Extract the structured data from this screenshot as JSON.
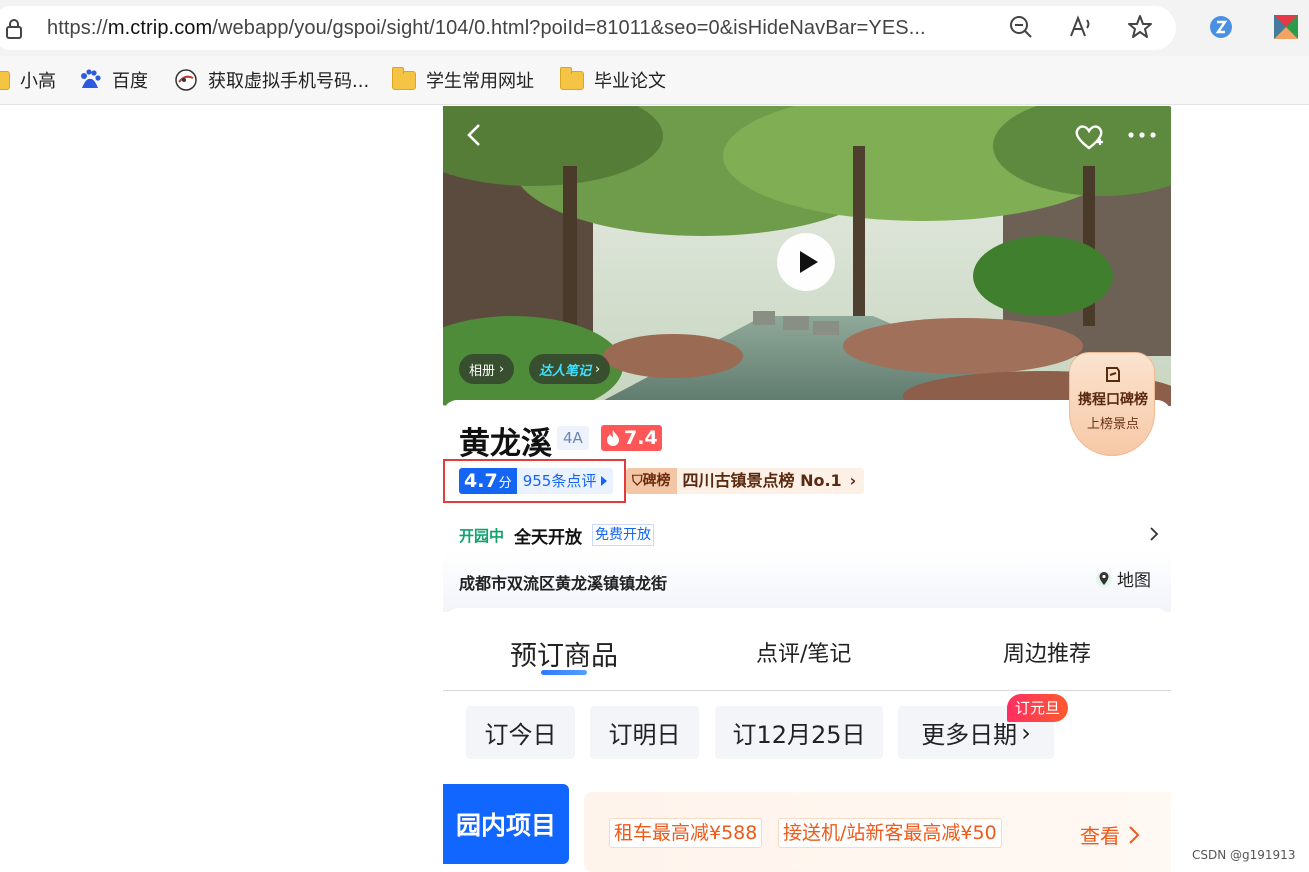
{
  "browser": {
    "url_prefix": "https://",
    "url_domain": "m.ctrip.com",
    "url_path": "/webapp/you/gspoi/sight/104/0.html?poiId=81011&seo=0&isHideNavBar=YES...",
    "icons": [
      "lock-icon",
      "zoom-out-icon",
      "read-aloud-icon",
      "favorite-star-icon",
      "extension-icon",
      "extension-icon-2"
    ]
  },
  "bookmarks": [
    {
      "label": "小高",
      "icon": "folder-icon"
    },
    {
      "label": "百度",
      "icon": "baidu-icon"
    },
    {
      "label": "获取虚拟手机号码...",
      "icon": "site-icon"
    },
    {
      "label": "学生常用网址",
      "icon": "folder-icon"
    },
    {
      "label": "毕业论文",
      "icon": "folder-icon"
    }
  ],
  "hero": {
    "album_label": "相册",
    "notes_label": "达人笔记"
  },
  "poi": {
    "name": "黄龙溪",
    "level": "4A",
    "heat": "7.4",
    "score": "4.7",
    "score_unit": "分",
    "reviews": "955条点评",
    "rank_tag": "碑榜",
    "rank_text": "四川古镇景点榜 No.1",
    "badge_line1": "携程口碑榜",
    "badge_line2": "上榜景点",
    "open_status": "开园中",
    "open_hours": "全天开放",
    "open_free": "免费开放",
    "address": "成都市双流区黄龙溪镇镇龙街",
    "map_label": "地图"
  },
  "tabs": [
    {
      "label": "预订商品",
      "active": true
    },
    {
      "label": "点评/笔记",
      "active": false
    },
    {
      "label": "周边推荐",
      "active": false
    }
  ],
  "dates": {
    "today": "订今日",
    "tomorrow": "订明日",
    "dec25": "订12月25日",
    "more": "更多日期",
    "promo": "订元旦"
  },
  "deals": {
    "park_label": "园内项目",
    "deal1": "租车最高减¥588",
    "deal2": "接送机/站新客最高减¥50",
    "more_label": "查看"
  },
  "watermark": "CSDN @g191913",
  "colors": {
    "brand_blue": "#1565f5",
    "heat_red": "#ff5757",
    "deal_orange": "#ee5a1a",
    "open_green": "#11a36b"
  }
}
